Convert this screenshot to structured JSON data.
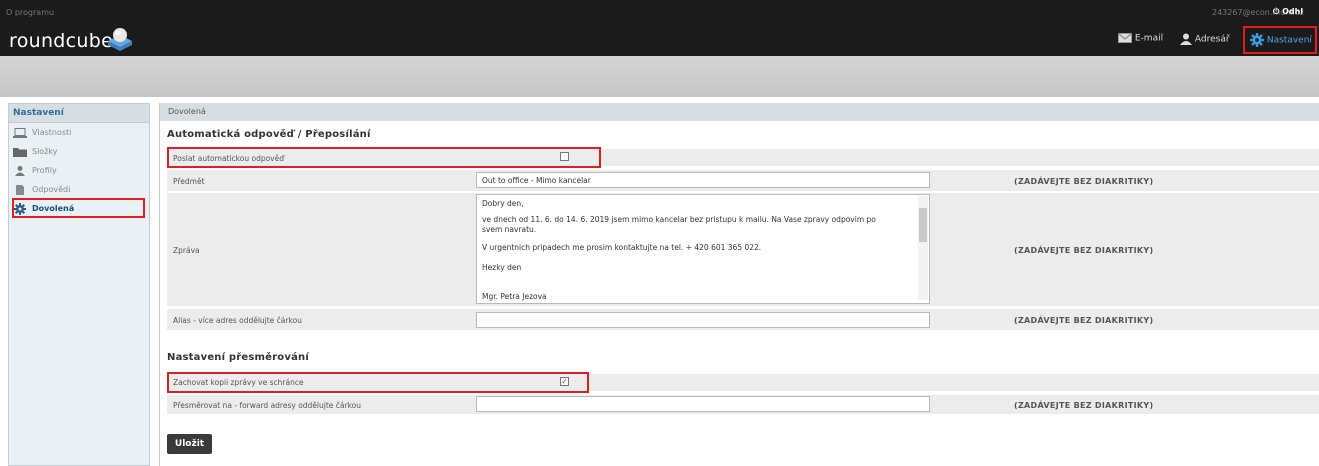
{
  "header": {
    "about": "O programu",
    "user_email": "243267@econ.muni.cz",
    "logout": "Odhl",
    "logo": "roundcube",
    "nav": [
      {
        "label": "E-mail",
        "icon": "envelope-icon"
      },
      {
        "label": "Adresář",
        "icon": "person-icon"
      },
      {
        "label": "Nastavení",
        "icon": "gear-icon"
      }
    ]
  },
  "sidebar": {
    "title": "Nastavení",
    "items": [
      {
        "label": "Vlastnosti",
        "icon": "laptop-icon"
      },
      {
        "label": "Složky",
        "icon": "folder-icon"
      },
      {
        "label": "Profily",
        "icon": "person-icon"
      },
      {
        "label": "Odpovědi",
        "icon": "document-icon"
      },
      {
        "label": "Dovolená",
        "icon": "gear-icon",
        "selected": true
      }
    ]
  },
  "main": {
    "breadcrumb": "Dovolená",
    "auto_reply": {
      "heading": "Automatická odpověď / Přeposílání",
      "send_label": "Poslat automatickou odpověď",
      "send_checked": false,
      "subject_label": "Předmět",
      "subject_value": "Out to office - Mimo kancelar",
      "subject_hint": "(ZADÁVEJTE BEZ DIAKRITIKY)",
      "message_label": "Zpráva",
      "message_lines": [
        "Dobry den,",
        "ve dnech od 11. 6. do 14. 6. 2019 jsem mimo kancelar bez pristupu k mailu. Na Vase zpravy odpovim po",
        "svem navratu.",
        "V urgentnich pripadech me prosim kontaktujte na tel. + 420 601 365 022.",
        "Hezky den",
        "Mgr. Petra Jezova"
      ],
      "message_hint": "(ZADÁVEJTE BEZ DIAKRITIKY)",
      "alias_label": "Alias - více adres oddělujte čárkou",
      "alias_value": "",
      "alias_hint": "(ZADÁVEJTE BEZ DIAKRITIKY)"
    },
    "forwarding": {
      "heading": "Nastavení přesměrování",
      "keep_copy_label": "Zachovat kopii zprávy ve schránce",
      "keep_copy_checked": true,
      "forward_label": "Přesměrovat na - forward adresy oddělujte čárkou",
      "forward_value": "",
      "forward_hint": "(ZADÁVEJTE BEZ DIAKRITIKY)"
    },
    "save_button": "Uložit"
  }
}
